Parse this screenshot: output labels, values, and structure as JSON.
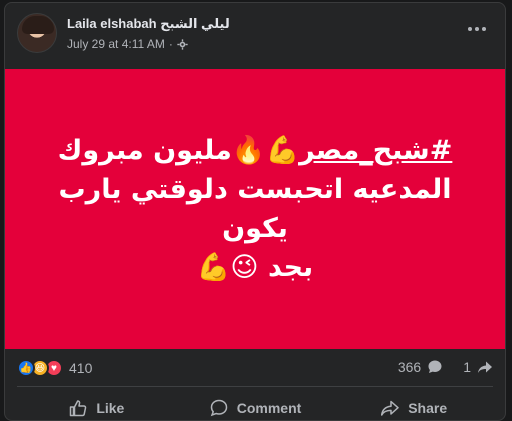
{
  "post": {
    "author": "Laila elshabah ليلي الشبح",
    "timestamp": "July 29 at 4:11 AM",
    "separator": "·",
    "audience_icon": "gear-icon"
  },
  "banner": {
    "background": "#e4003a",
    "hashtag": "#شبح_مصر",
    "text_line1_rest": "💪🔥مليون مبروك",
    "text_line2": "المدعيه اتحبست دلوقتي يارب يكون",
    "text_line3": "بجد 😉💪"
  },
  "stats": {
    "reaction_count": "410",
    "comment_count": "366",
    "share_count": "1",
    "reactions": [
      "like-icon",
      "haha-icon",
      "love-icon"
    ]
  },
  "actions": {
    "like_label": "Like",
    "comment_label": "Comment",
    "share_label": "Share"
  }
}
